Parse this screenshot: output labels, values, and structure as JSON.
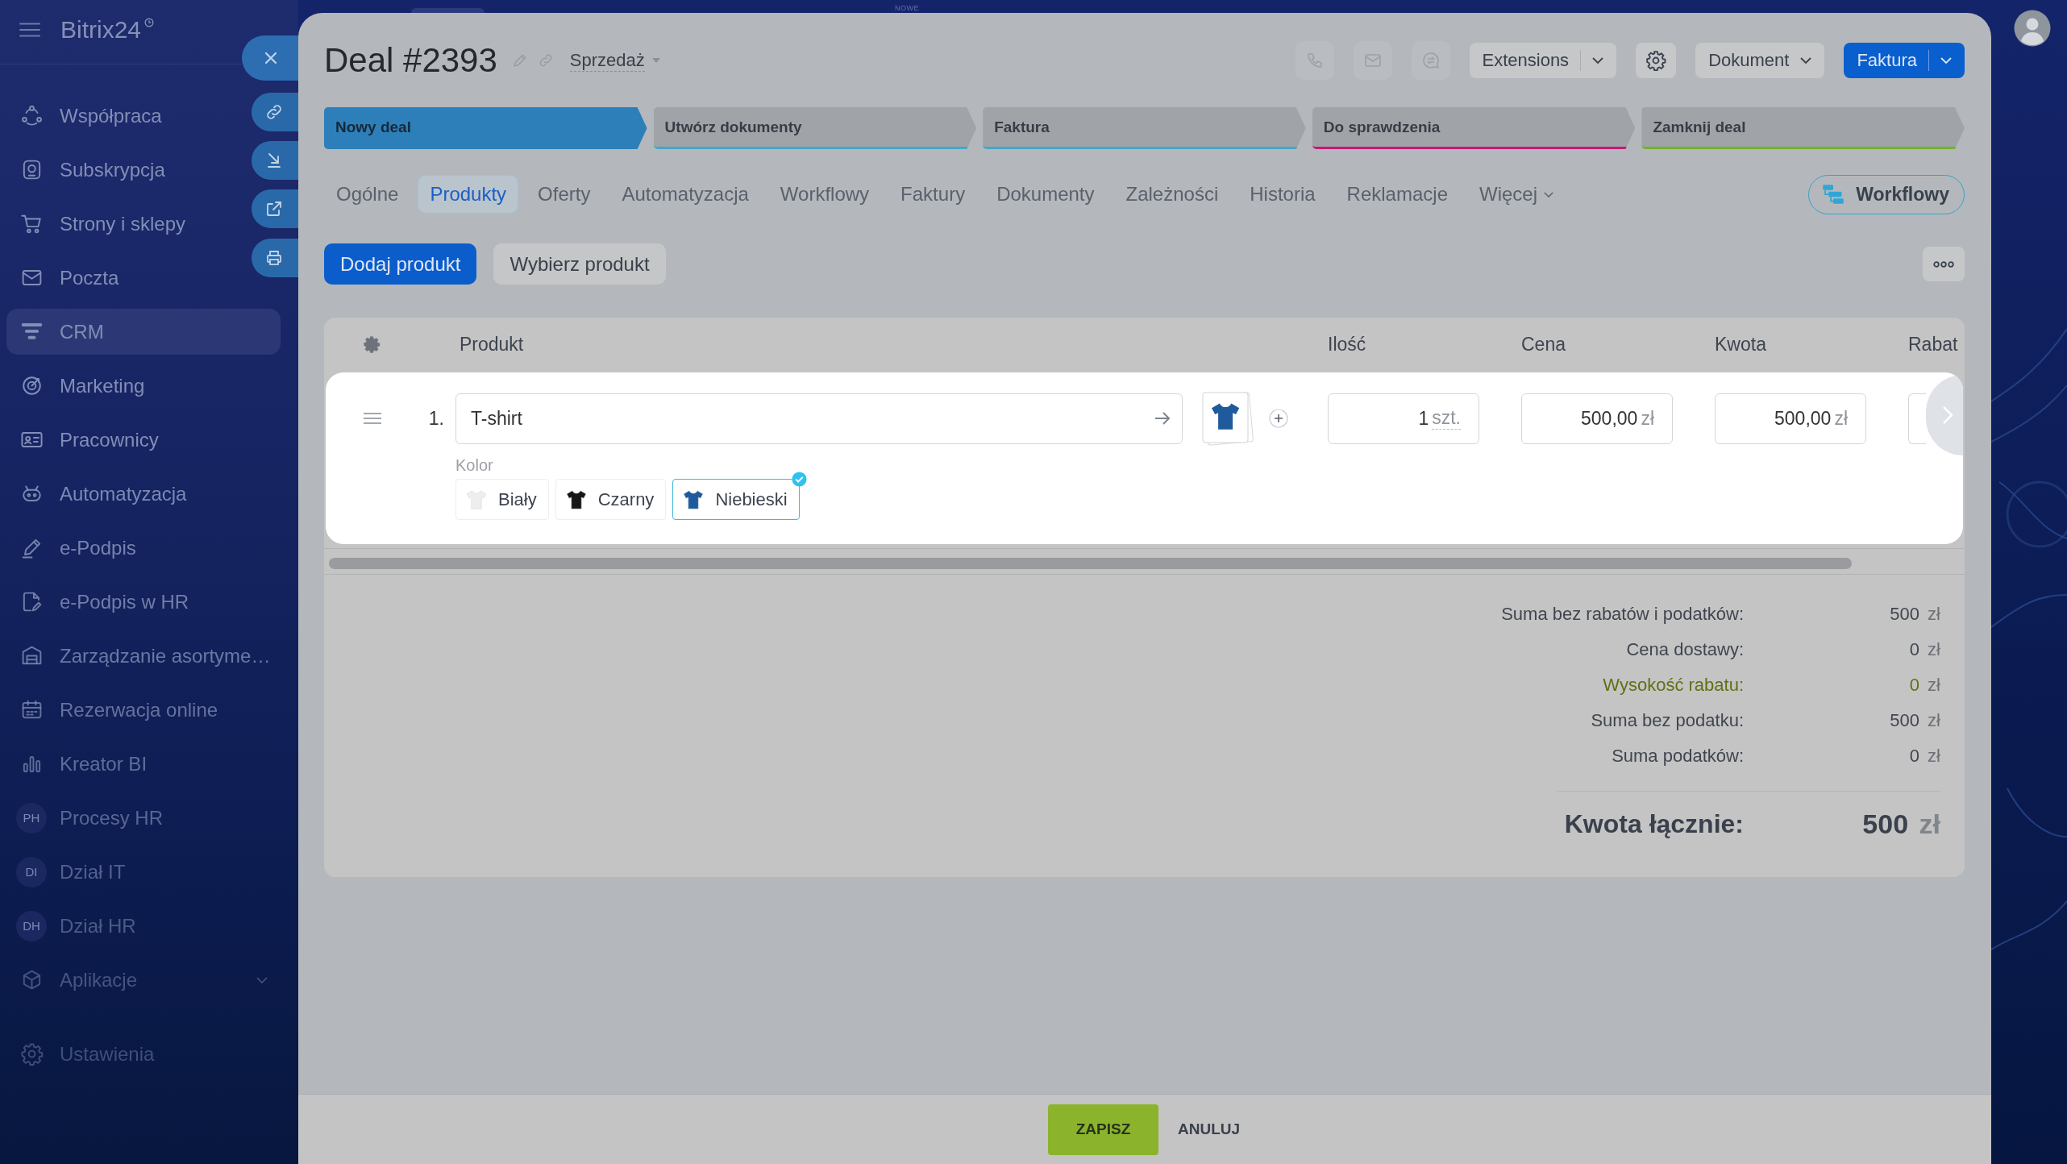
{
  "sidebar": {
    "logo": "Bitrix24",
    "items": [
      {
        "label": "Współpraca",
        "kind": "link",
        "selected": false
      },
      {
        "label": "Subskrypcja",
        "kind": "link",
        "selected": false
      },
      {
        "label": "Strony i sklepy",
        "kind": "link",
        "selected": false
      },
      {
        "label": "Poczta",
        "kind": "link",
        "selected": false
      },
      {
        "label": "CRM",
        "kind": "link",
        "selected": true
      },
      {
        "label": "Marketing",
        "kind": "link",
        "selected": false
      },
      {
        "label": "Pracownicy",
        "kind": "link",
        "selected": false
      },
      {
        "label": "Automatyzacja",
        "kind": "link",
        "selected": false
      },
      {
        "label": "e-Podpis",
        "kind": "link",
        "selected": false
      },
      {
        "label": "e-Podpis w HR",
        "kind": "link",
        "selected": false
      },
      {
        "label": "Zarządzanie asortyme…",
        "kind": "link",
        "selected": false
      },
      {
        "label": "Rezerwacja online",
        "kind": "link",
        "selected": false
      },
      {
        "label": "Kreator BI",
        "kind": "link",
        "selected": false
      },
      {
        "label": "Procesy HR",
        "kind": "avatar",
        "initials": "PH",
        "selected": false
      },
      {
        "label": "Dział IT",
        "kind": "avatar",
        "initials": "DI",
        "selected": false
      },
      {
        "label": "Dział HR",
        "kind": "avatar",
        "initials": "DH",
        "selected": false
      },
      {
        "label": "Aplikacje",
        "kind": "group",
        "selected": false
      }
    ],
    "settings": "Ustawienia"
  },
  "top_bar": {
    "badge": "NOWE"
  },
  "deal": {
    "title": "Deal #2393",
    "pipeline": "Sprzedaż"
  },
  "header_buttons": {
    "extensions": "Extensions",
    "document": "Dokument",
    "invoice": "Faktura"
  },
  "stages": [
    {
      "label": "Nowy deal",
      "color": "#2d7fb9",
      "selected": true
    },
    {
      "label": "Utwórz dokumenty",
      "color": "#43a7cb",
      "selected": false
    },
    {
      "label": "Faktura",
      "color": "#43a7cb",
      "selected": false
    },
    {
      "label": "Do sprawdzenia",
      "color": "#c8177a",
      "selected": false
    },
    {
      "label": "Zamknij deal",
      "color": "#72b42b",
      "selected": false
    }
  ],
  "tabs": [
    {
      "label": "Ogólne",
      "kind": "tab",
      "selected": false
    },
    {
      "label": "Produkty",
      "kind": "tab",
      "selected": true
    },
    {
      "label": "Oferty",
      "kind": "tab",
      "selected": false
    },
    {
      "label": "Automatyzacja",
      "kind": "tab",
      "selected": false
    },
    {
      "label": "Workflowy",
      "kind": "tab",
      "selected": false
    },
    {
      "label": "Faktury",
      "kind": "tab",
      "selected": false
    },
    {
      "label": "Dokumenty",
      "kind": "tab",
      "selected": false
    },
    {
      "label": "Zależności",
      "kind": "tab",
      "selected": false
    },
    {
      "label": "Historia",
      "kind": "tab",
      "selected": false
    },
    {
      "label": "Reklamacje",
      "kind": "tab",
      "selected": false
    },
    {
      "label": "Więcej",
      "kind": "menu",
      "selected": false
    }
  ],
  "workflow_button": "Workflowy",
  "product_buttons": {
    "add": "Dodaj produkt",
    "choose": "Wybierz produkt"
  },
  "table": {
    "columns": [
      "Produkt",
      "Ilość",
      "Cena",
      "Kwota",
      "Rabat"
    ],
    "rows": [
      {
        "number": "1.",
        "name": "T-shirt",
        "quantity": "1",
        "unit": "szt.",
        "price": "500,00",
        "price_currency": "zł",
        "amount": "500,00",
        "amount_currency": "zł",
        "property": "Kolor",
        "variants": [
          {
            "label": "Biały",
            "color": "#eeeeee",
            "selected": false
          },
          {
            "label": "Czarny",
            "color": "#161616",
            "selected": false
          },
          {
            "label": "Niebieski",
            "color": "#1f5a9c",
            "selected": true
          }
        ]
      }
    ]
  },
  "totals": {
    "rows": [
      {
        "label": "Suma bez rabatów i podatków:",
        "value": "500",
        "currency": "zł",
        "kind": "plain"
      },
      {
        "label": "Cena dostawy:",
        "value": "0",
        "currency": "zł",
        "kind": "plain"
      },
      {
        "label": "Wysokość rabatu:",
        "value": "0",
        "currency": "zł",
        "kind": "discount"
      },
      {
        "label": "Suma bez podatku:",
        "value": "500",
        "currency": "zł",
        "kind": "plain"
      },
      {
        "label": "Suma podatków:",
        "value": "0",
        "currency": "zł",
        "kind": "plain"
      }
    ],
    "grand_total": {
      "label": "Kwota łącznie:",
      "value": "500",
      "currency": "zł"
    }
  },
  "footer": {
    "save": "ZAPISZ",
    "cancel": "ANULUJ"
  }
}
